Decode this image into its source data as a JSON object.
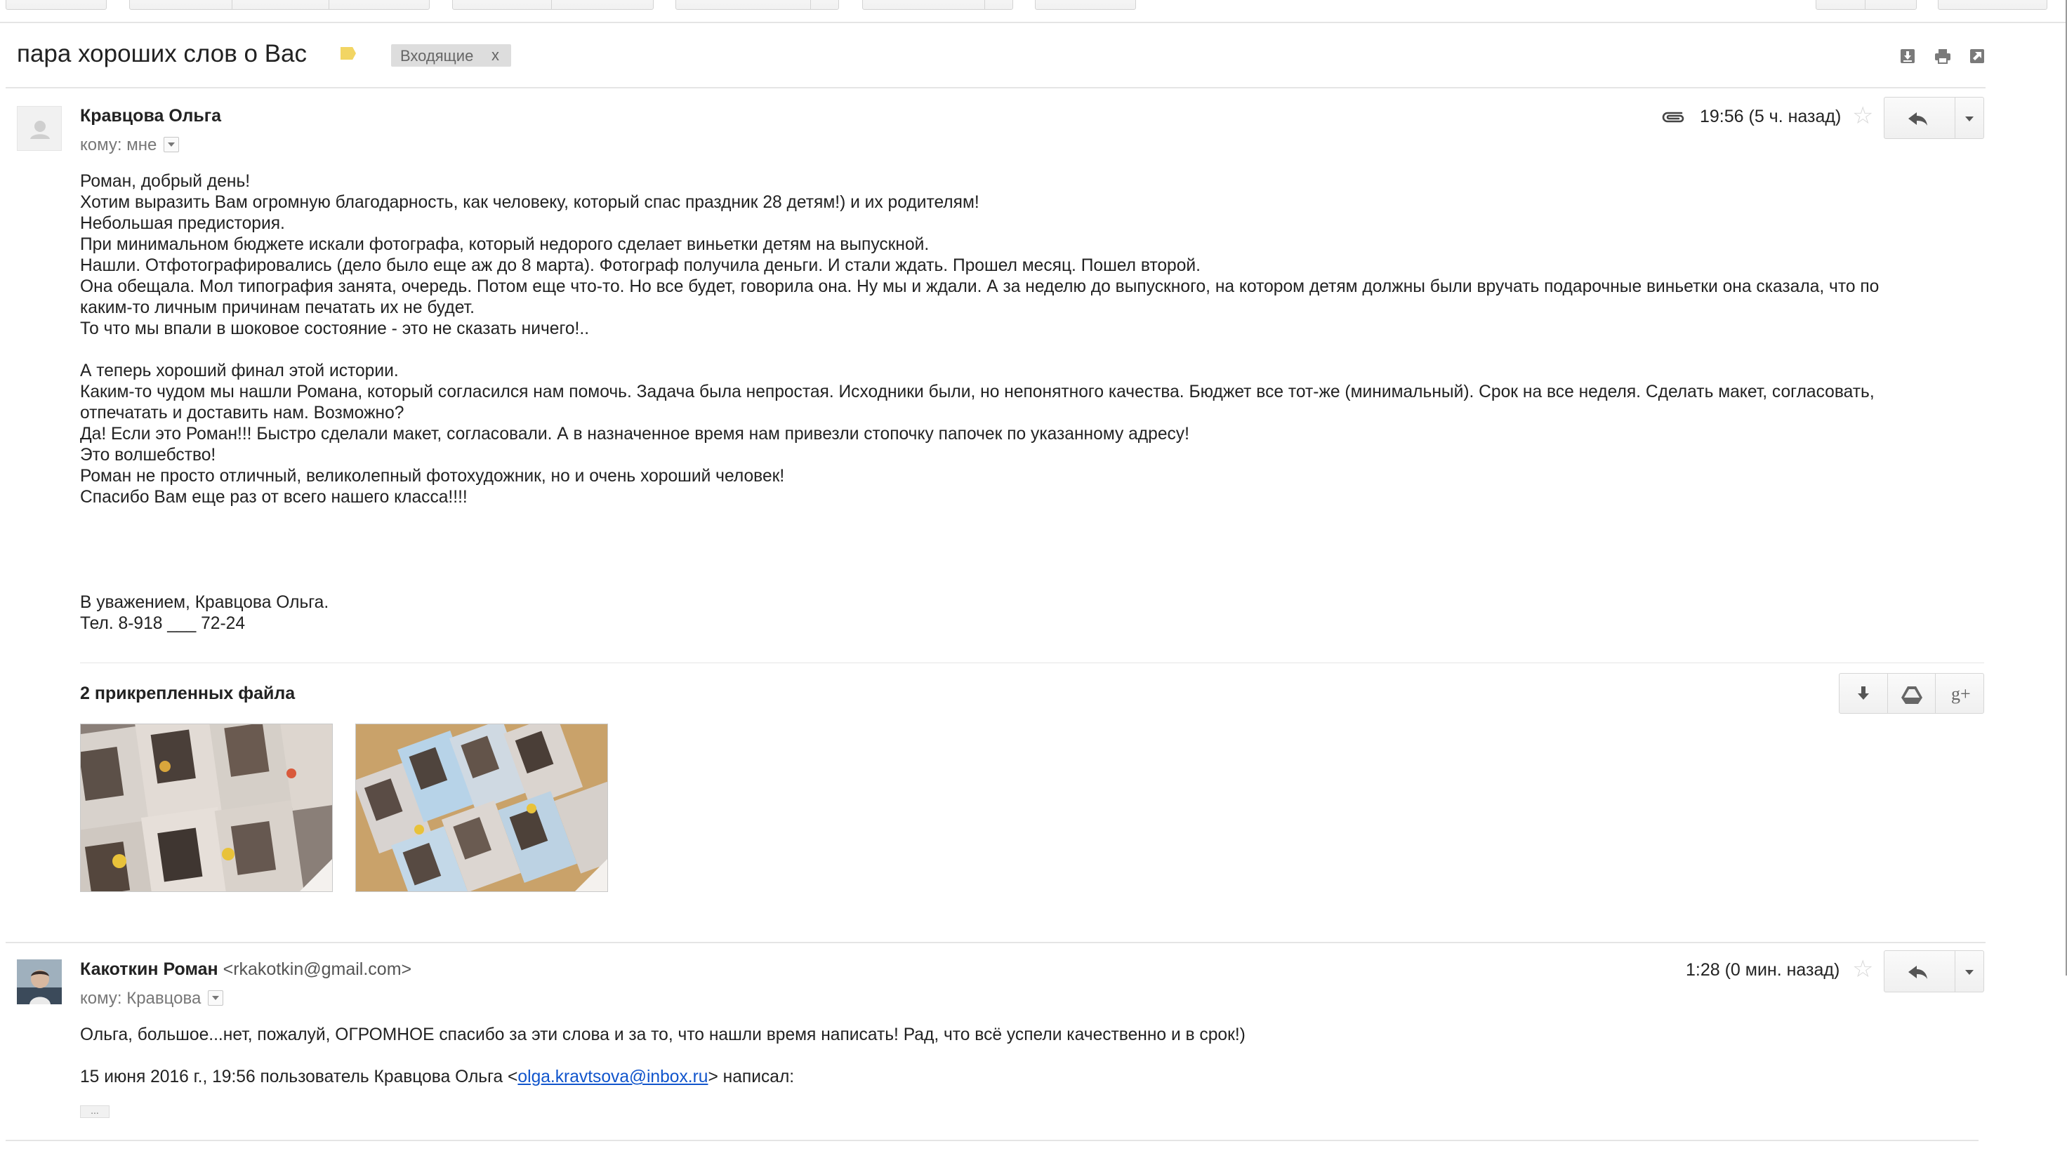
{
  "thread": {
    "subject": "пара хороших слов о Вас",
    "label": "Входящие",
    "label_remove": "x",
    "actions": [
      "download-all-icon",
      "print-icon",
      "new-window-icon"
    ]
  },
  "message1": {
    "sender": "Кравцова Ольга",
    "to": "кому: мне",
    "time": "19:56 (5 ч. назад)",
    "lines": [
      "Роман, добрый день!",
      "Хотим выразить Вам огромную благодарность, как человеку, который спас праздник 28 детям!) и их родителям!",
      "Небольшая предистория.",
      "При минимальном бюджете искали фотографа, который недорого сделает виньетки детям на выпускной.",
      "Нашли. Отфотографировались (дело было еще аж до 8 марта). Фотограф получила деньги. И стали ждать. Прошел месяц. Пошел второй.",
      "Она обещала. Мол типография занята, очередь. Потом еще что-то. Но все будет, говорила она. Ну мы и ждали. А за неделю до выпускного, на котором детям должны были вручать подарочные виньетки она сказала, что по",
      "каким-то личным причинам печатать их не будет.",
      "То что мы впали в шоковое состояние - это не сказать ничего!..",
      "",
      "А теперь хороший финал этой истории.",
      "Каким-то чудом мы нашли Романа, который  согласился нам помочь. Задача была непростая. Исходники были, но непонятного качества. Бюджет все тот-же (минимальный). Срок на все неделя. Сделать макет, согласовать,",
      "отпечатать и доставить нам. Возможно?",
      "Да! Если это Роман!!! Быстро сделали макет, согласовали. А в назначенное время нам привезли стопочку папочек по указанному адресу!",
      "Это волшебство!",
      "Роман не просто отличный, великолепный фотохудожник, но и очень хороший человек!",
      "Спасибо Вам еще раз от всего нашего класса!!!!"
    ],
    "signature": [
      "В уважением, Кравцова Ольга.",
      "Тел. 8-918 ___ 72-24"
    ],
    "attachments_title": "2 прикрепленных файла",
    "attachment_actions": [
      "download-icon",
      "drive-icon",
      "google-plus-icon"
    ],
    "attachments": [
      "photo-thumbnail-1",
      "photo-thumbnail-2"
    ]
  },
  "message2": {
    "sender": "Какоткин Роман",
    "sender_email": "<rkakotkin@gmail.com>",
    "to": "кому: Кравцова",
    "time": "1:28 (0 мин. назад)",
    "body": "Ольга, большое...нет, пожалуй, ОГРОМНОЕ спасибо за эти слова и за то, что нашли время написать! Рад, что всё успели качественно и в срок!)",
    "quote_prefix": "15 июня 2016 г., 19:56 пользователь Кравцова Ольга <",
    "quote_email": "olga.kravtsova@inbox.ru",
    "quote_suffix": "> написал:",
    "show_trimmed": "..."
  },
  "colors": {
    "label_yellow": "#f2d563",
    "link": "#1155cc",
    "badge_bg": "#dddddd"
  }
}
